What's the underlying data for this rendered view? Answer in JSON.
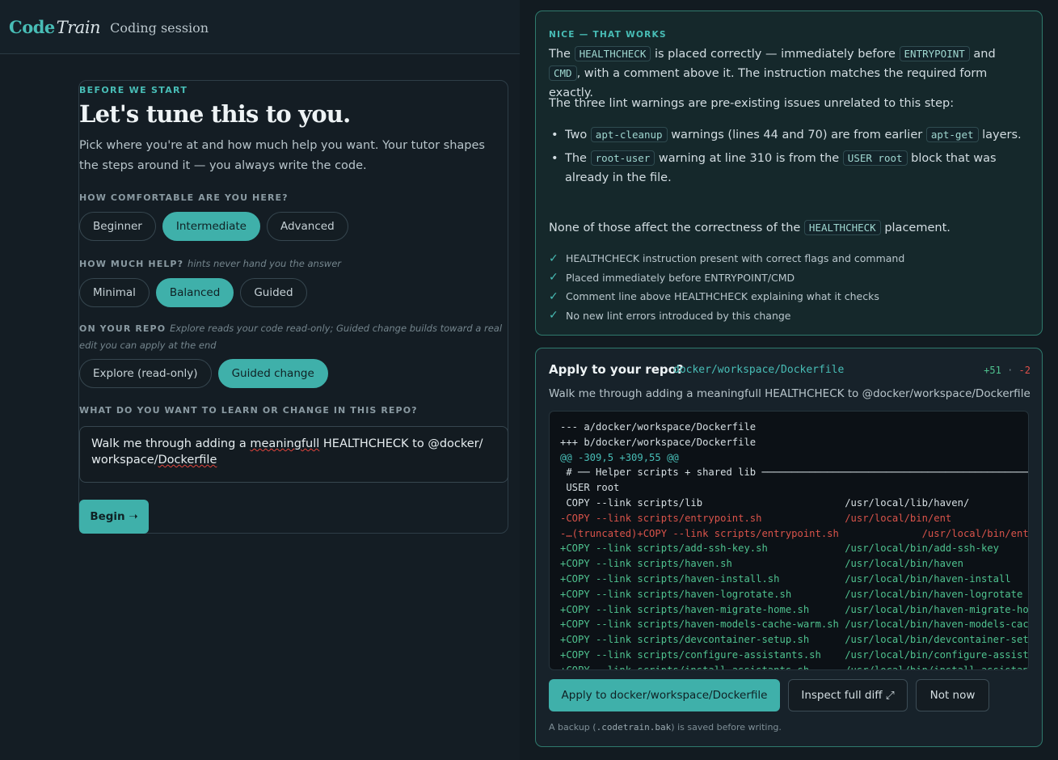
{
  "app": {
    "logo_code": "Code",
    "logo_train": "Train",
    "session_title": "Coding session"
  },
  "setup": {
    "kicker": "BEFORE WE START",
    "headline": "Let's tune this to you.",
    "subtitle": "Pick where you're at and how much help you want. Your tutor shapes the steps around it — you always write the code.",
    "comfort_label": "HOW COMFORTABLE ARE YOU HERE?",
    "comfort_options": [
      "Beginner",
      "Intermediate",
      "Advanced"
    ],
    "comfort_selected": "Intermediate",
    "help_label": "HOW MUCH HELP?",
    "help_hint": "hints never hand you the answer",
    "help_options": [
      "Minimal",
      "Balanced",
      "Guided"
    ],
    "help_selected": "Balanced",
    "repo_label": "ON YOUR REPO",
    "repo_hint": "Explore reads your code read-only; Guided change builds toward a real edit you can apply at the end",
    "repo_options": [
      "Explore (read-only)",
      "Guided change"
    ],
    "repo_selected": "Guided change",
    "learn_label": "WHAT DO YOU WANT TO LEARN OR CHANGE IN THIS REPO?",
    "learn_value_1": "Walk me through adding a ",
    "learn_value_2": "meaningfull",
    "learn_value_3": " HEALTHCHECK to @docker/",
    "learn_value_4": "workspace/",
    "learn_value_5": "Dockerfile",
    "begin_label": "Begin ➝"
  },
  "feedback": {
    "kicker": "NICE — THAT WORKS",
    "p1_a": "The ",
    "p1_code1": "HEALTHCHECK",
    "p1_b": " is placed correctly — immediately before ",
    "p1_code2": "ENTRYPOINT",
    "p1_c": " and ",
    "p1_code3": "CMD",
    "p1_d": ", with a comment above it. The instruction matches the required form exactly.",
    "p2": "The three lint warnings are pre-existing issues unrelated to this step:",
    "b1_a": "Two ",
    "b1_code1": "apt-cleanup",
    "b1_b": " warnings (lines 44 and 70) are from earlier ",
    "b1_code2": "apt-get",
    "b1_c": " layers.",
    "b2_a": "The ",
    "b2_code1": "root-user",
    "b2_b": " warning at line 310 is from the ",
    "b2_code2": "USER root",
    "b2_c": " block that was already in the file.",
    "p3_a": "None of those affect the correctness of the ",
    "p3_code": "HEALTHCHECK",
    "p3_b": " placement.",
    "checks": [
      "HEALTHCHECK instruction present with correct flags and command",
      "Placed immediately before ENTRYPOINT/CMD",
      "Comment line above HEALTHCHECK explaining what it checks",
      "No new lint errors introduced by this change"
    ]
  },
  "apply": {
    "title": "Apply to your repo?",
    "path": "docker/workspace/Dockerfile",
    "additions": "+51",
    "separator": "·",
    "deletions": "-2",
    "description": "Walk me through adding a meaningfull HEALTHCHECK to @docker/workspace/Dockerfile",
    "diff_lines": [
      {
        "kind": "hdr",
        "text": "--- a/docker/workspace/Dockerfile"
      },
      {
        "kind": "hdr",
        "text": "+++ b/docker/workspace/Dockerfile"
      },
      {
        "kind": "hunk",
        "text": "@@ -309,5 +309,55 @@"
      },
      {
        "kind": "ctx",
        "text": " # ── Helper scripts + shared lib ─────────────────────────────────────────────────"
      },
      {
        "kind": "ctx",
        "text": " USER root"
      },
      {
        "kind": "ctx",
        "text": " COPY --link scripts/lib                        /usr/local/lib/haven/"
      },
      {
        "kind": "del",
        "text": "-COPY --link scripts/entrypoint.sh              /usr/local/bin/ent"
      },
      {
        "kind": "del",
        "text": "-…(truncated)+COPY --link scripts/entrypoint.sh              /usr/local/bin/entrypoint.sh"
      },
      {
        "kind": "add",
        "text": "+COPY --link scripts/add-ssh-key.sh             /usr/local/bin/add-ssh-key"
      },
      {
        "kind": "add",
        "text": "+COPY --link scripts/haven.sh                   /usr/local/bin/haven"
      },
      {
        "kind": "add",
        "text": "+COPY --link scripts/haven-install.sh           /usr/local/bin/haven-install"
      },
      {
        "kind": "add",
        "text": "+COPY --link scripts/haven-logrotate.sh         /usr/local/bin/haven-logrotate"
      },
      {
        "kind": "add",
        "text": "+COPY --link scripts/haven-migrate-home.sh      /usr/local/bin/haven-migrate-home"
      },
      {
        "kind": "add",
        "text": "+COPY --link scripts/haven-models-cache-warm.sh /usr/local/bin/haven-models-cache-warm"
      },
      {
        "kind": "add",
        "text": "+COPY --link scripts/devcontainer-setup.sh      /usr/local/bin/devcontainer-setup"
      },
      {
        "kind": "add",
        "text": "+COPY --link scripts/configure-assistants.sh    /usr/local/bin/configure-assistants"
      },
      {
        "kind": "add",
        "text": "+COPY --link scripts/install-assistants.sh      /usr/local/bin/install-assistants"
      }
    ],
    "apply_button": "Apply to docker/workspace/Dockerfile",
    "inspect_button": "Inspect full diff ⤢",
    "not_now_button": "Not now",
    "foot_a": "A backup (",
    "foot_code": ".codetrain.bak",
    "foot_b": ") is saved before writing."
  }
}
